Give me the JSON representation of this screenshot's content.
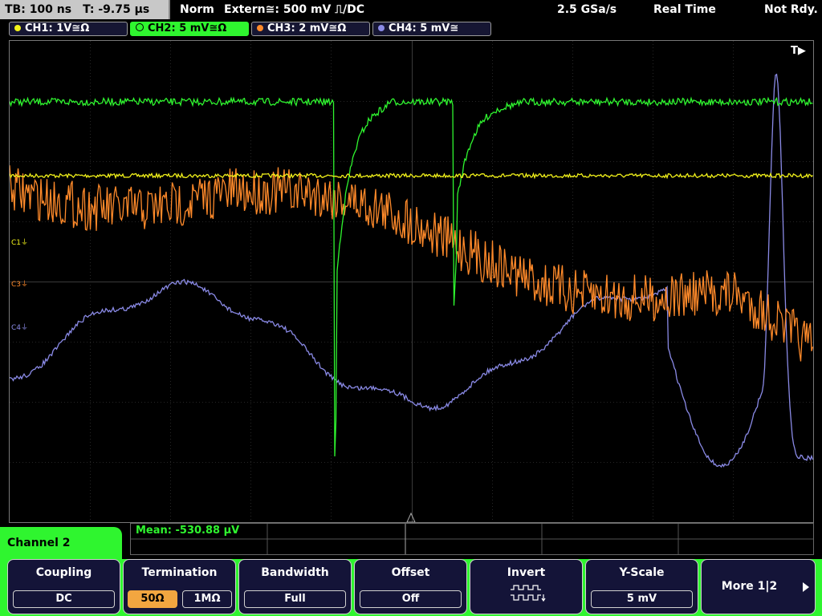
{
  "status": {
    "timebase": "TB: 100 ns",
    "trigger_time": "T: -9.75 µs",
    "mode": "Norm",
    "trigger_source": "Extern≅: 500 mV ⎍/DC",
    "sample_rate": "2.5 GSa/s",
    "acq_mode": "Real Time",
    "readiness": "Not Rdy."
  },
  "channels": [
    {
      "label": "CH1: 1V≅Ω",
      "color": "#f2f21a"
    },
    {
      "label": "CH2: 5 mV≅Ω",
      "color": "#2ff52f"
    },
    {
      "label": "CH3: 2 mV≅Ω",
      "color": "#ff8a2a"
    },
    {
      "label": "CH4: 5 mV≅",
      "color": "#8a8ae6"
    }
  ],
  "markers": {
    "trigger": "T▶",
    "c1": "C1⏚",
    "c3": "C3⏚",
    "c4": "C4⏚"
  },
  "measurement": "Mean: -530.88 µV",
  "active_channel": "Channel 2",
  "softkeys": {
    "coupling": {
      "label": "Coupling",
      "value": "DC"
    },
    "termination": {
      "label": "Termination",
      "option_a": "50Ω",
      "option_b": "1MΩ"
    },
    "bandwidth": {
      "label": "Bandwidth",
      "value": "Full"
    },
    "offset": {
      "label": "Offset",
      "value": "Off"
    },
    "invert": {
      "label": "Invert"
    },
    "yscale": {
      "label": "Y-Scale",
      "value": "5 mV"
    },
    "more": {
      "label": "More 1|2"
    }
  }
}
